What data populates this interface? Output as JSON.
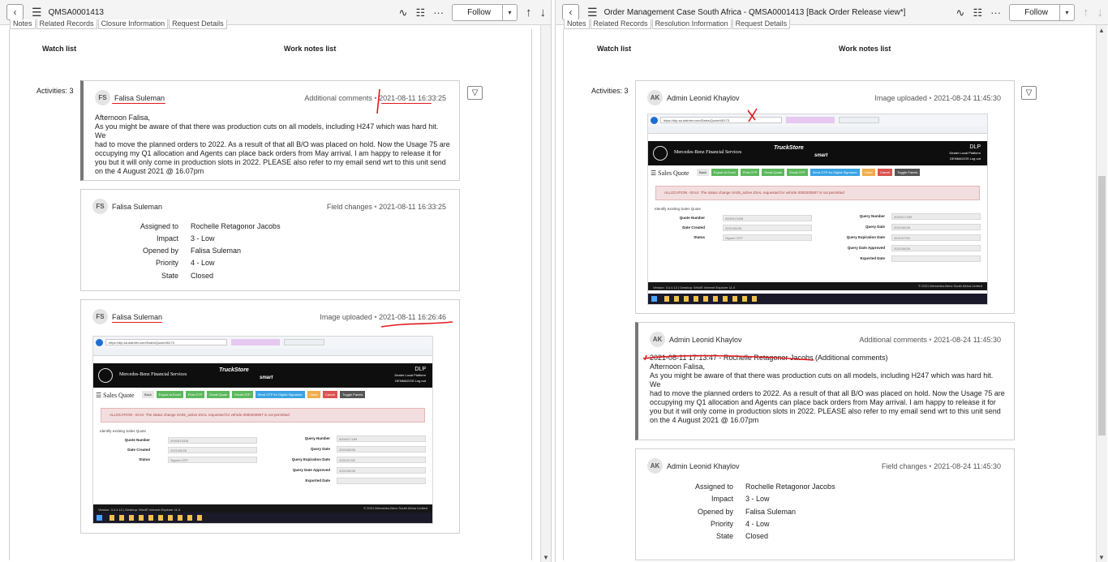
{
  "left": {
    "title": "QMSA0001413",
    "follow_label": "Follow",
    "tabs": [
      "Notes",
      "Related Records",
      "Closure Information",
      "Request Details"
    ],
    "watch_list": "Watch list",
    "work_notes_list": "Work notes list",
    "activities": "Activities: 3",
    "entries": [
      {
        "initials": "FS",
        "author": "Falisa Suleman",
        "type": "Additional comments",
        "time": "2021-08-11 16:33:25",
        "lines": [
          "Afternoon Falisa,",
          "As you might be aware of that there was production cuts on all models, including H247 which was hard hit. We",
          "had to move the planned orders to 2022. As a result of that all B/O was placed on hold. Now the Usage 75 are",
          "occupying my Q1 allocation and Agents can place back orders from May arrival. I am happy to release it for",
          "you but it will only come in production slots in 2022. PLEASE also refer to my email send wrt to this unit send",
          "on the 4 August 2021 @ 16.07pm"
        ]
      },
      {
        "initials": "FS",
        "author": "Falisa Suleman",
        "type": "Field changes",
        "time": "2021-08-11 16:33:25",
        "fields": [
          {
            "label": "Assigned to",
            "value": "Rochelle Retagonor Jacobs"
          },
          {
            "label": "Impact",
            "value": "3 - Low"
          },
          {
            "label": "Opened by",
            "value": "Falisa Suleman"
          },
          {
            "label": "Priority",
            "value": "4 - Low"
          },
          {
            "label": "State",
            "value": "Closed"
          }
        ]
      },
      {
        "initials": "FS",
        "author": "Falisa Suleman",
        "type": "Image uploaded",
        "time": "2021-08-11 16:26:46"
      }
    ]
  },
  "right": {
    "title": "Order Management Case South Africa - QMSA0001413 [Back Order Release view*]",
    "follow_label": "Follow",
    "tabs": [
      "Notes",
      "Related Records",
      "Resolution Information",
      "Request Details"
    ],
    "watch_list": "Watch list",
    "work_notes_list": "Work notes list",
    "activities": "Activities: 3",
    "entries": [
      {
        "initials": "AK",
        "author": "Admin Leonid Khaylov",
        "type": "Image uploaded",
        "time": "2021-08-24 11:45:30"
      },
      {
        "initials": "AK",
        "author": "Admin Leonid Khaylov",
        "type": "Additional comments",
        "time": "2021-08-24 11:45:30",
        "lines": [
          "2021-08-11 17:13:47 - Rochelle Retagonor Jacobs (Additional comments)",
          "Afternoon Falisa,",
          "As you might be aware of that there was production cuts on all models, including H247 which was hard hit. We",
          "had to move the planned orders to 2022. As a result of that all B/O was placed on hold. Now the Usage 75 are",
          "occupying my Q1 allocation and Agents can place back orders from May arrival. I am happy to release it for",
          "you but it will only come in production slots in 2022. PLEASE also refer to my email send wrt to this unit send",
          "on the 4 August 2021 @ 16.07pm"
        ]
      },
      {
        "initials": "AK",
        "author": "Admin Leonid Khaylov",
        "type": "Field changes",
        "time": "2021-08-24 11:45:30",
        "fields": [
          {
            "label": "Assigned to",
            "value": "Rochelle Retagonor Jacobs"
          },
          {
            "label": "Impact",
            "value": "3 - Low"
          },
          {
            "label": "Opened by",
            "value": "Falisa Suleman"
          },
          {
            "label": "Priority",
            "value": "4 - Low"
          },
          {
            "label": "State",
            "value": "Closed"
          }
        ]
      }
    ]
  },
  "screenshot": {
    "section_title": "Sales Quote",
    "back": "Back",
    "buttons": [
      {
        "label": "Export to Excel",
        "color": "#5cb85c"
      },
      {
        "label": "Print OTP",
        "color": "#5cb85c"
      },
      {
        "label": "Email Quote",
        "color": "#5cb85c"
      },
      {
        "label": "Email OTP",
        "color": "#5cb85c"
      },
      {
        "label": "Send OTP for Digital Signature",
        "color": "#3aa3e3"
      },
      {
        "label": "Order",
        "color": "#f0ad4e"
      },
      {
        "label": "Cancel",
        "color": "#d9534f"
      },
      {
        "label": "Toggle Panels",
        "color": "#555555"
      }
    ],
    "alert": "ALLOCATION - Error: The status change SA05_active ZSAL requested for vehicle 0000200907 is not permitted",
    "identify": "Identify existing Sales Quote",
    "left_fields": [
      {
        "label": "Quote Number",
        "value": "0000513428"
      },
      {
        "label": "Date Created",
        "value": "2021/06/26"
      },
      {
        "label": "Status",
        "value": "Signed OTP"
      }
    ],
    "right_fields": [
      {
        "label": "Query Number",
        "value": "0000517189"
      },
      {
        "label": "Query Date",
        "value": "2021/06/26"
      },
      {
        "label": "Query Expiration Date",
        "value": "2021/07/02"
      },
      {
        "label": "Query Date Approved",
        "value": "2021/06/26"
      },
      {
        "label": "Exported Date",
        "value": ""
      }
    ],
    "brand": "Mercedes-Benz Financial Services",
    "truckstore": "TruckStore",
    "smart": "smart",
    "dlp_title": "DLP",
    "dlp_sub": "Dealer Local Platform",
    "dlp_user": "DENMAGOS",
    "dlp_logout": "Log out",
    "footer": "Version: 3.4.4.12  |  Desktop: Win/IE Internet Explorer 11.0",
    "copyright": "© 2021 Mercedes-Benz South Africa Limited",
    "url": "https://dlp-sa.daimler.com/Sales/Quote/45173"
  },
  "colors": {
    "annotation": "#e0191e",
    "accent_bar": "#777777"
  }
}
